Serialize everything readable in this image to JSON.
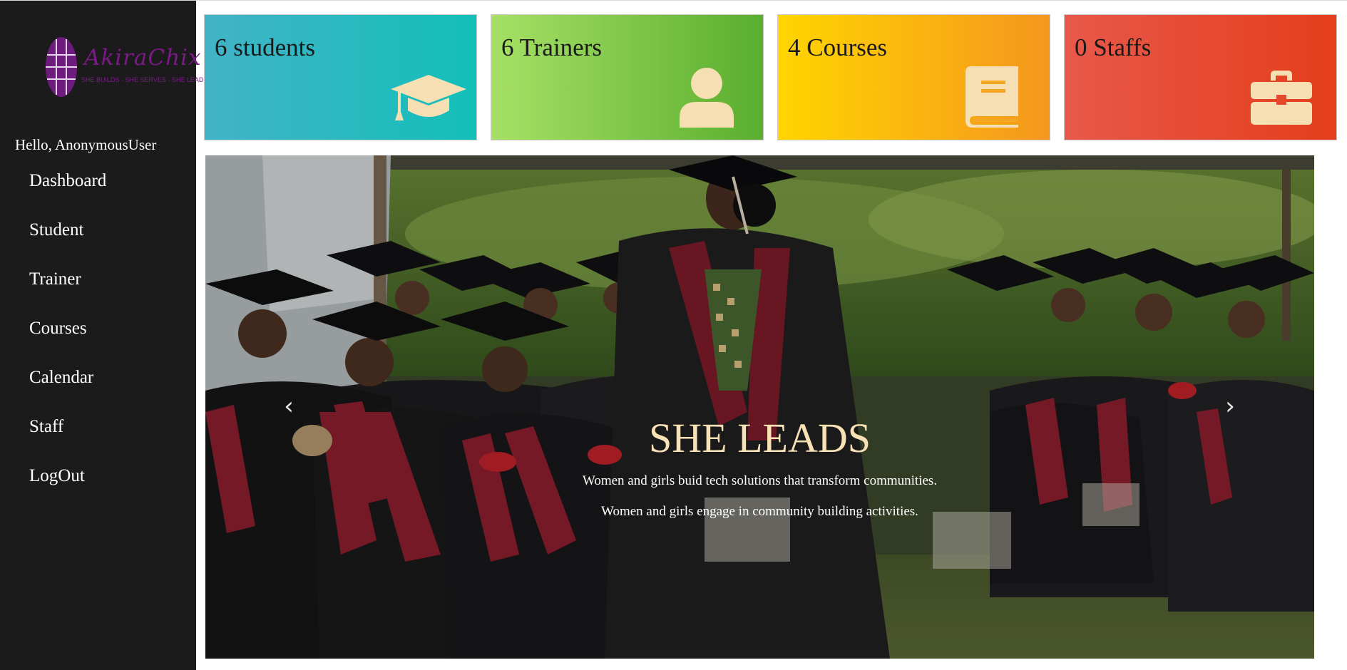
{
  "sidebar": {
    "logo": {
      "brand": "AkiraChix",
      "tagline": "SHE BUILDS · SHE SERVES · SHE LEADS"
    },
    "greeting": "Hello, AnonymousUser",
    "nav": [
      {
        "label": "Dashboard"
      },
      {
        "label": "Student"
      },
      {
        "label": "Trainer"
      },
      {
        "label": "Courses"
      },
      {
        "label": "Calendar"
      },
      {
        "label": "Staff"
      },
      {
        "label": "LogOut"
      }
    ]
  },
  "stats": [
    {
      "label": "6 students",
      "icon": "graduation-cap-icon",
      "gradient": [
        "#42b3c7",
        "#13bfb9"
      ]
    },
    {
      "label": "6 Trainers",
      "icon": "user-icon",
      "gradient": [
        "#a6e065",
        "#5aae2f"
      ]
    },
    {
      "label": "4 Courses",
      "icon": "book-icon",
      "gradient": [
        "#ffd500",
        "#f5961e"
      ]
    },
    {
      "label": "0 Staffs",
      "icon": "briefcase-icon",
      "gradient": [
        "#e8584a",
        "#e43e1b"
      ]
    }
  ],
  "carousel": {
    "title": "SHE LEADS",
    "line1": "Women and girls buid tech solutions that transform communities.",
    "line2": "Women and girls engage in community building activities.",
    "prev_icon": "chevron-left-icon",
    "next_icon": "chevron-right-icon"
  },
  "colors": {
    "sidebar_bg": "#1b1b1b",
    "icon_fill": "#f6dfb2",
    "caption_title": "#f7e1b5",
    "gown_stole": "#8e1f2e"
  }
}
